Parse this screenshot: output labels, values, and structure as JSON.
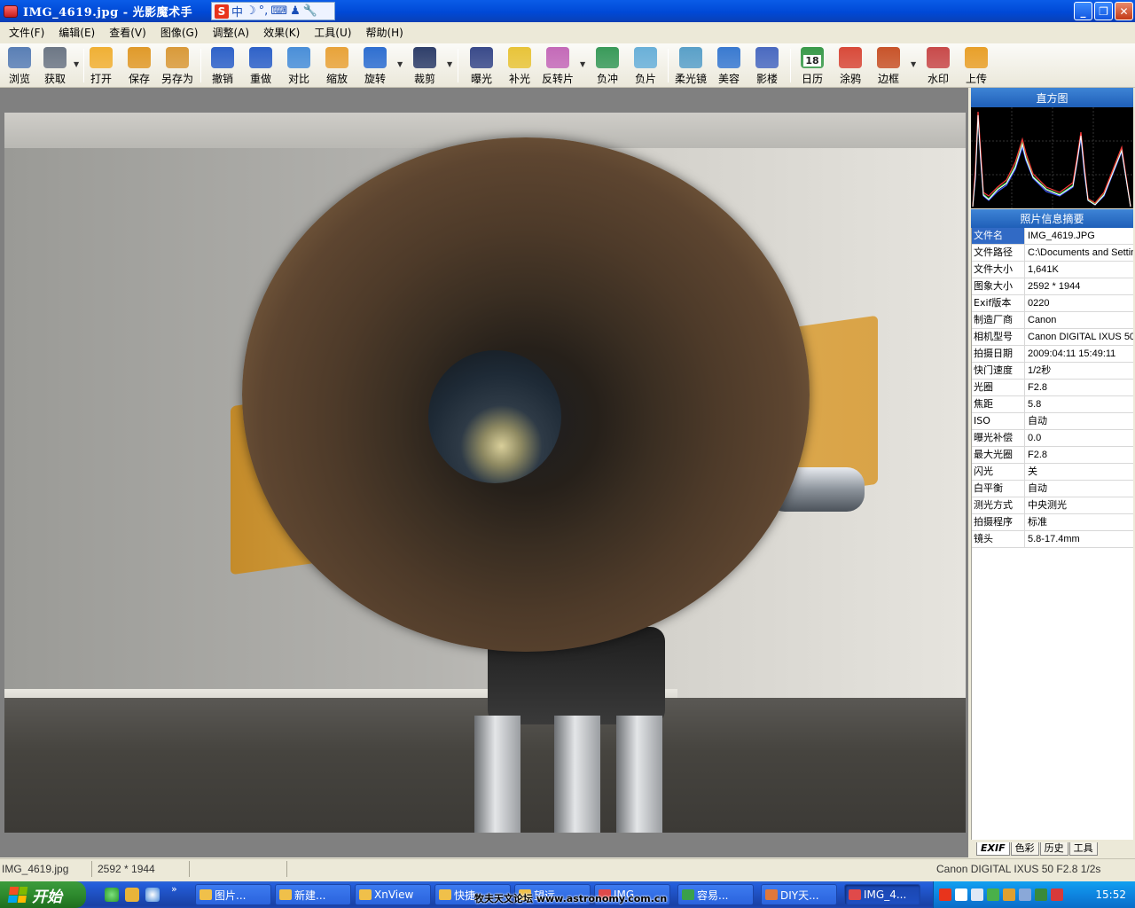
{
  "window": {
    "title": "IMG_4619.jpg - 光影魔术手",
    "minimize": "_",
    "maximize": "❐",
    "close": "✕"
  },
  "ime": {
    "logo": "S",
    "lang": "中",
    "items": [
      "☽",
      "°,",
      "⌨",
      "♟",
      "🔧"
    ]
  },
  "menu": [
    {
      "label": "文件(F)"
    },
    {
      "label": "编辑(E)"
    },
    {
      "label": "查看(V)"
    },
    {
      "label": "图像(G)"
    },
    {
      "label": "调整(A)"
    },
    {
      "label": "效果(K)"
    },
    {
      "label": "工具(U)"
    },
    {
      "label": "帮助(H)"
    }
  ],
  "toolbar": [
    {
      "label": "浏览",
      "icon": "browse-eye-icon",
      "color": "#5a7fb5"
    },
    {
      "label": "获取",
      "icon": "camera-icon",
      "color": "#6d7785"
    },
    {
      "label": "打开",
      "icon": "folder-icon",
      "color": "#f0b035"
    },
    {
      "label": "保存",
      "icon": "save-disk-icon",
      "color": "#e09a2a"
    },
    {
      "label": "另存为",
      "icon": "save-as-icon",
      "color": "#d99a3a"
    },
    {
      "label": "撤销",
      "icon": "undo-icon",
      "color": "#2f62c8"
    },
    {
      "label": "重做",
      "icon": "redo-icon",
      "color": "#2f62c8"
    },
    {
      "label": "对比",
      "icon": "compare-icon",
      "color": "#4a8fd8"
    },
    {
      "label": "缩放",
      "icon": "resize-icon",
      "color": "#e8a33a"
    },
    {
      "label": "旋转",
      "icon": "rotate-icon",
      "color": "#2f6fd0"
    },
    {
      "label": "裁剪",
      "icon": "crop-icon",
      "color": "#2f3f6a"
    },
    {
      "label": "曝光",
      "icon": "exposure-sun-icon",
      "color": "#3a4a8a"
    },
    {
      "label": "补光",
      "icon": "fill-light-bulb-icon",
      "color": "#e8c43a"
    },
    {
      "label": "反转片",
      "icon": "reversal-film-icon",
      "color": "#c46ab8"
    },
    {
      "label": "负冲",
      "icon": "cross-process-icon",
      "color": "#3a9a5a"
    },
    {
      "label": "负片",
      "icon": "negative-icon",
      "color": "#6ab0d8"
    },
    {
      "label": "柔光镜",
      "icon": "soft-focus-icon",
      "color": "#5aa0c8"
    },
    {
      "label": "美容",
      "icon": "beauty-face-icon",
      "color": "#3a7ad0"
    },
    {
      "label": "影楼",
      "icon": "studio-icon",
      "color": "#4a6ac0"
    },
    {
      "label": "日历",
      "icon": "calendar-icon",
      "color": "#3a9a4a",
      "text": "18"
    },
    {
      "label": "涂鸦",
      "icon": "doodle-pen-icon",
      "color": "#d84a3a"
    },
    {
      "label": "边框",
      "icon": "border-frame-icon",
      "color": "#c8542a"
    },
    {
      "label": "水印",
      "icon": "watermark-icon",
      "color": "#c84a4a"
    },
    {
      "label": "上传",
      "icon": "upload-icon",
      "color": "#e8a02a"
    }
  ],
  "histogram": {
    "title": "直方图"
  },
  "info": {
    "title": "照片信息摘要",
    "rows": [
      {
        "key": "文件名",
        "value": "IMG_4619.JPG"
      },
      {
        "key": "文件路径",
        "value": "C:\\Documents and Settin"
      },
      {
        "key": "文件大小",
        "value": "1,641K"
      },
      {
        "key": "图象大小",
        "value": "2592 * 1944"
      },
      {
        "key": "Exif版本",
        "value": "0220"
      },
      {
        "key": "制造厂商",
        "value": "Canon"
      },
      {
        "key": "相机型号",
        "value": "Canon DIGITAL IXUS 50"
      },
      {
        "key": "拍摄日期",
        "value": "2009:04:11 15:49:11"
      },
      {
        "key": "快门速度",
        "value": "1/2秒"
      },
      {
        "key": "光圈",
        "value": "F2.8"
      },
      {
        "key": "焦距",
        "value": "5.8"
      },
      {
        "key": "ISO",
        "value": "自动"
      },
      {
        "key": "曝光补偿",
        "value": "0.0"
      },
      {
        "key": "最大光圈",
        "value": "F2.8"
      },
      {
        "key": "闪光",
        "value": "关"
      },
      {
        "key": "白平衡",
        "value": "自动"
      },
      {
        "key": "测光方式",
        "value": "中央测光"
      },
      {
        "key": "拍摄程序",
        "value": "标准"
      },
      {
        "key": "镜头",
        "value": "5.8-17.4mm"
      }
    ]
  },
  "panel_tabs": [
    "EXIF",
    "色彩",
    "历史",
    "工具"
  ],
  "status": {
    "filename": "IMG_4619.jpg",
    "size": "2592 * 1944",
    "camera": "Canon DIGITAL IXUS 50 F2.8 1/2s"
  },
  "taskbar": {
    "start": "开始",
    "tasks": [
      {
        "label": "图片...",
        "color": "#f0c04a"
      },
      {
        "label": "新建...",
        "color": "#f0c04a"
      },
      {
        "label": "XnView",
        "color": "#f0c04a"
      },
      {
        "label": "快捷",
        "color": "#f0c04a"
      },
      {
        "label": "望远",
        "color": "#f0c04a"
      },
      {
        "label": "IMG",
        "color": "#e04a4a"
      },
      {
        "label": "容易...",
        "color": "#3aa04a"
      },
      {
        "label": "DIY天...",
        "color": "#e0783a"
      },
      {
        "label": "IMG_4...",
        "color": "#e04a4a"
      }
    ],
    "clock": "15:52"
  },
  "watermark": "牧夫天文论坛 www.astronomy.com.cn"
}
